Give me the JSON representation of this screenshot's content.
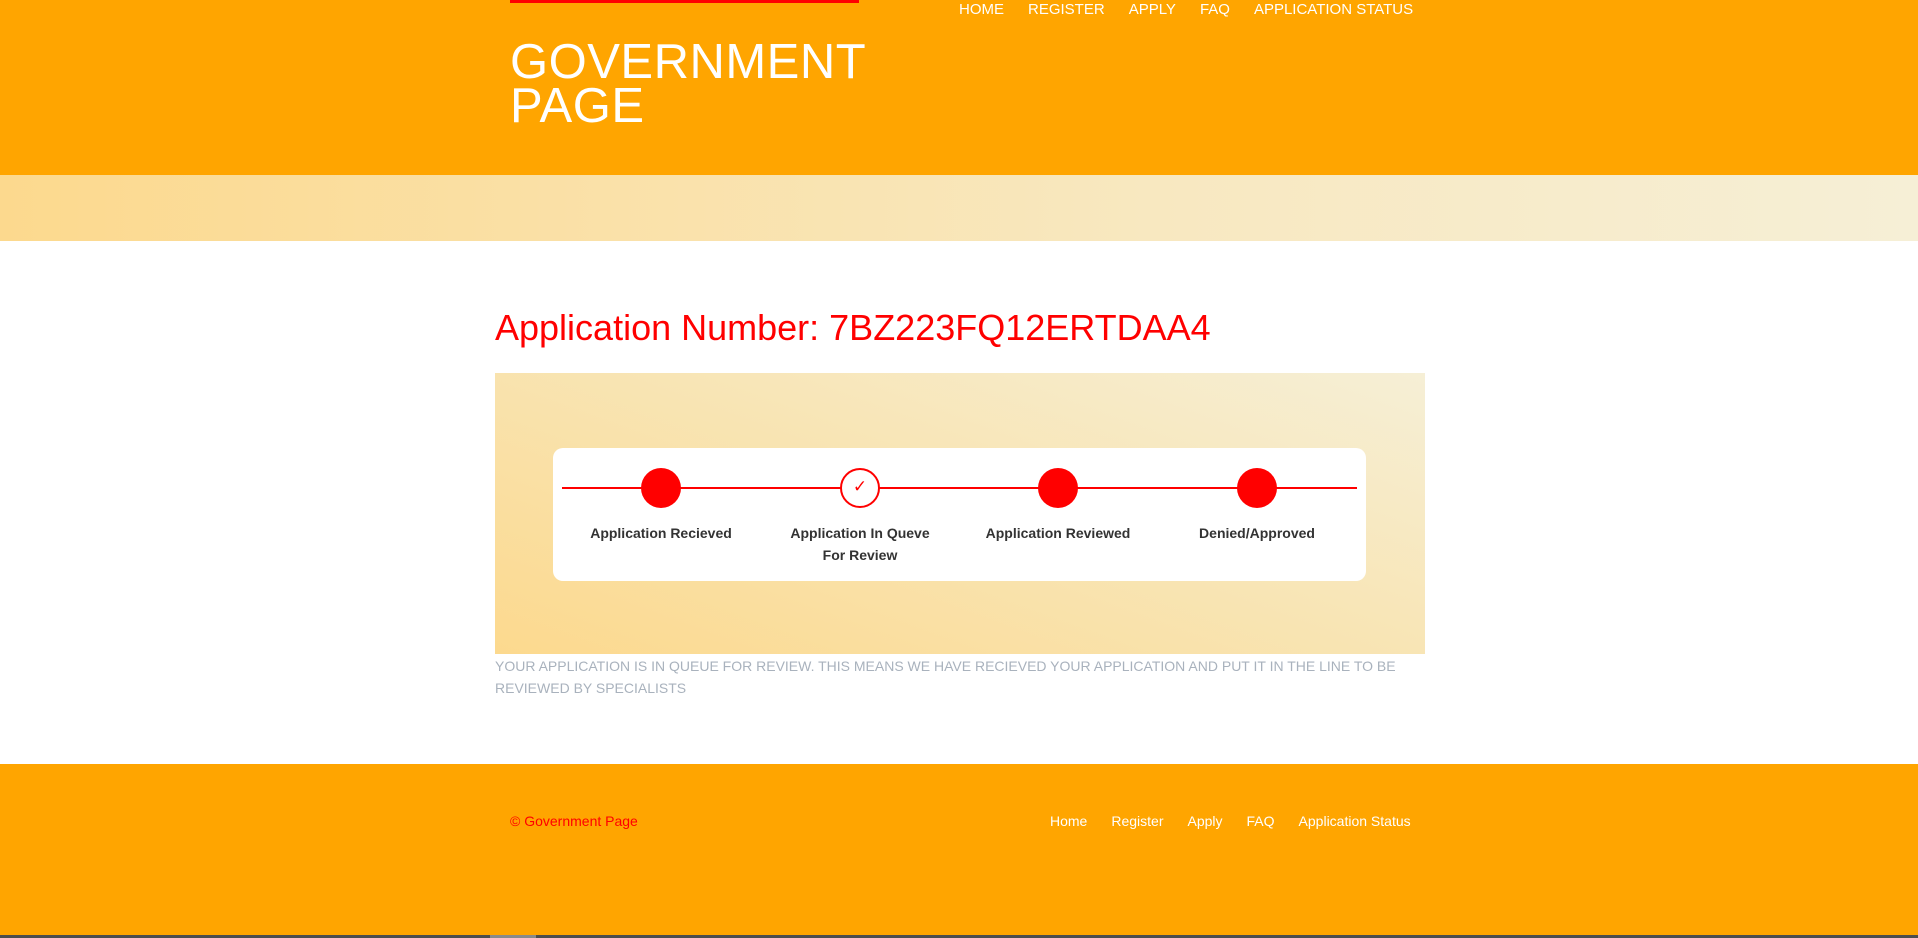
{
  "header": {
    "brand_title": "GOVERNMENT PAGE",
    "nav": [
      {
        "label": "HOME"
      },
      {
        "label": "REGISTER"
      },
      {
        "label": "APPLY"
      },
      {
        "label": "FAQ"
      },
      {
        "label": "APPLICATION STATUS"
      }
    ]
  },
  "main": {
    "application_number": "Application Number: 7BZ223FQ12ERTDAA4",
    "steps": [
      {
        "label": "Application Recieved",
        "state": "complete"
      },
      {
        "label": "Application In Queve For Review",
        "state": "current",
        "icon": "checkmark-icon"
      },
      {
        "label": "Application Reviewed",
        "state": "pending"
      },
      {
        "label": "Denied/Approved",
        "state": "pending"
      }
    ],
    "status_message": "YOUR APPLICATION IS IN QUEUE FOR REVIEW. THIS MEANS WE HAVE RECIEVED YOUR APPLICATION AND PUT IT IN THE LINE TO BE REVIEWED BY SPECIALISTS"
  },
  "footer": {
    "copyright": "© Government Page",
    "nav": [
      {
        "label": "Home"
      },
      {
        "label": "Register"
      },
      {
        "label": "Apply"
      },
      {
        "label": "FAQ"
      },
      {
        "label": "Application Status"
      }
    ]
  },
  "colors": {
    "primary": "#ffa500",
    "accent": "#ff0000",
    "muted_text": "#a9b2bd"
  },
  "icons": {
    "current_step": "✓"
  }
}
